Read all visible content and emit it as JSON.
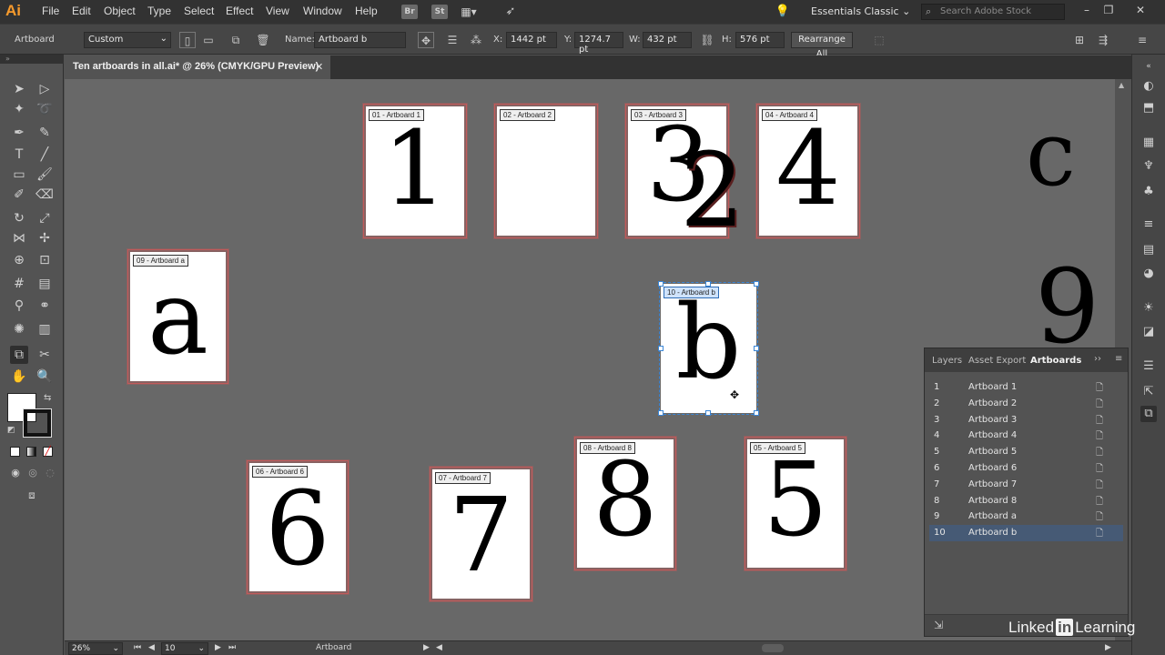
{
  "app": {
    "logo": "Ai",
    "brand_color": "#f79a2c"
  },
  "menu": [
    "File",
    "Edit",
    "Object",
    "Type",
    "Select",
    "Effect",
    "View",
    "Window",
    "Help"
  ],
  "bar_icons": {
    "bridge": "Br",
    "stock": "St"
  },
  "workspace": {
    "label": "Essentials Classic"
  },
  "search": {
    "placeholder": "Search Adobe Stock"
  },
  "control": {
    "tool_label": "Artboard",
    "preset": "Custom",
    "name_label": "Name:",
    "name_value": "Artboard b",
    "x_label": "X:",
    "x_value": "1442 pt",
    "y_label": "Y:",
    "y_value": "1274.7 pt",
    "w_label": "W:",
    "w_value": "432 pt",
    "h_label": "H:",
    "h_value": "576 pt",
    "rearrange": "Rearrange All"
  },
  "document": {
    "tab_title": "Ten artboards in all.ai* @ 26% (CMYK/GPU Preview)",
    "close": "✕"
  },
  "artboards_on_canvas": [
    {
      "label": "01 - Artboard 1",
      "glyph": "1"
    },
    {
      "label": "02 - Artboard 2",
      "glyph": ""
    },
    {
      "label": "03 - Artboard 3",
      "glyph": "3"
    },
    {
      "label": "04 - Artboard 4",
      "glyph": "4"
    },
    {
      "label": "09 - Artboard a",
      "glyph": "a"
    },
    {
      "label": "10 - Artboard b",
      "glyph": "b"
    },
    {
      "label": "06 - Artboard 6",
      "glyph": "6"
    },
    {
      "label": "07 - Artboard 7",
      "glyph": "7"
    },
    {
      "label": "08 - Artboard 8",
      "glyph": "8"
    },
    {
      "label": "05 - Artboard 5",
      "glyph": "5"
    }
  ],
  "loose_glyphs": {
    "two": "2",
    "c": "c",
    "nine": "9"
  },
  "panel": {
    "tabs": [
      "Layers",
      "Asset Export",
      "Artboards"
    ],
    "active_tab": "Artboards",
    "rows": [
      {
        "num": "1",
        "name": "Artboard 1"
      },
      {
        "num": "2",
        "name": "Artboard 2"
      },
      {
        "num": "3",
        "name": "Artboard 3"
      },
      {
        "num": "4",
        "name": "Artboard 4"
      },
      {
        "num": "5",
        "name": "Artboard 5"
      },
      {
        "num": "6",
        "name": "Artboard 6"
      },
      {
        "num": "7",
        "name": "Artboard 7"
      },
      {
        "num": "8",
        "name": "Artboard 8"
      },
      {
        "num": "9",
        "name": "Artboard a"
      },
      {
        "num": "10",
        "name": "Artboard b"
      }
    ],
    "selected_row": "10"
  },
  "status": {
    "zoom": "26%",
    "artboard_num": "10",
    "mode": "Artboard"
  },
  "watermark": {
    "pre": "Linked",
    "in": "in",
    "post": "Learning"
  }
}
